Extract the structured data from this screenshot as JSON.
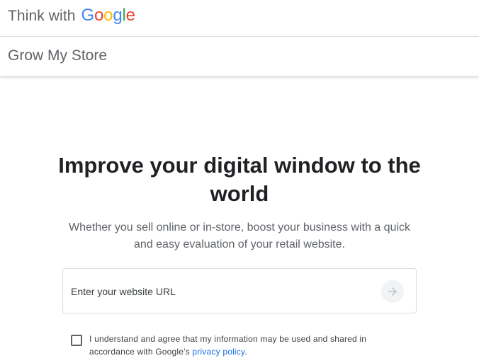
{
  "header": {
    "prefix": "Think with",
    "logo_letters": [
      {
        "char": "G",
        "color": "#4285F4"
      },
      {
        "char": "o",
        "color": "#EA4335"
      },
      {
        "char": "o",
        "color": "#FBBC05"
      },
      {
        "char": "g",
        "color": "#4285F4"
      },
      {
        "char": "l",
        "color": "#34A853"
      },
      {
        "char": "e",
        "color": "#EA4335"
      }
    ]
  },
  "subheader": {
    "title": "Grow My Store"
  },
  "hero": {
    "title_line1": "Improve your digital window to the",
    "title_line2": "world",
    "subtitle_line1": "Whether you sell online or in-store, boost your business with a quick",
    "subtitle_line2": "and easy evaluation of your retail website."
  },
  "url_form": {
    "placeholder": "Enter your website URL",
    "value": "",
    "submit_icon": "arrow-right-icon"
  },
  "consent": {
    "checked": false,
    "text_before_link": "I understand and agree that my information may be used and shared in accordance with Google's ",
    "link_text": "privacy policy",
    "text_after_link": "."
  },
  "colors": {
    "link": "#1a73e8",
    "text_primary": "#202124",
    "text_secondary": "#5f6368",
    "border": "#dadce0"
  }
}
